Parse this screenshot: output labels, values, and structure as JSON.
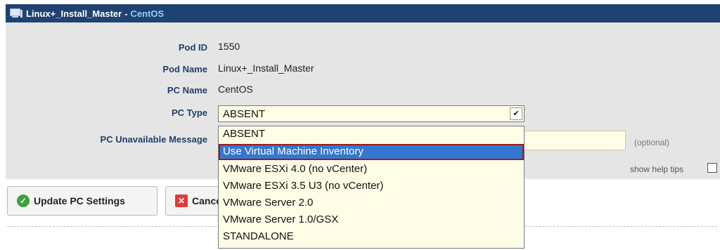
{
  "window": {
    "title": "Linux+_Install_Master",
    "separator": "-",
    "subtitle": "CentOS"
  },
  "fields": {
    "pod_id": {
      "label": "Pod ID",
      "value": "1550"
    },
    "pod_name": {
      "label": "Pod Name",
      "value": "Linux+_Install_Master"
    },
    "pc_name": {
      "label": "PC Name",
      "value": "CentOS"
    },
    "pc_type": {
      "label": "PC Type",
      "value": "ABSENT"
    },
    "pc_unavailable_message": {
      "label": "PC Unavailable Message",
      "value": "",
      "hint": "(optional)"
    }
  },
  "dropdown": {
    "options": [
      "ABSENT",
      "Use Virtual Machine Inventory",
      "VMware ESXi 4.0 (no vCenter)",
      "VMware ESXi 3.5 U3 (no vCenter)",
      "VMware Server 2.0",
      "VMware Server 1.0/GSX",
      "STANDALONE"
    ],
    "highlighted": "Use Virtual Machine Inventory"
  },
  "help_tips_label": "show help tips",
  "buttons": {
    "update": "Update PC Settings",
    "cancel": "Cancel"
  },
  "colors": {
    "header_bg": "#1f4271",
    "label_text": "#1f3f6e",
    "highlight": "#3377d0",
    "highlight_border": "#9e1a1a"
  }
}
